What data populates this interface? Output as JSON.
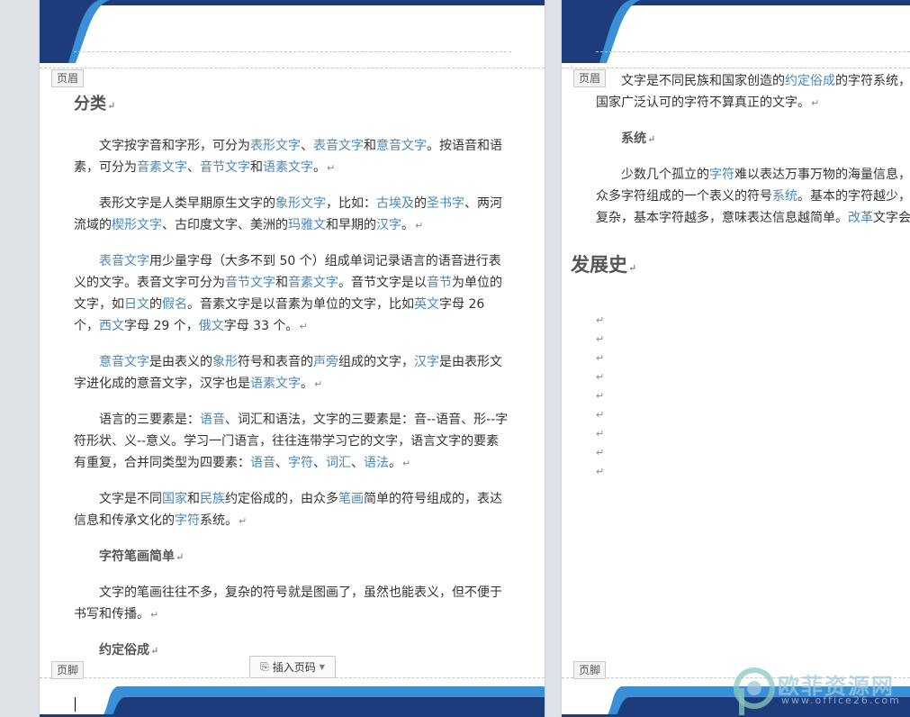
{
  "colors": {
    "accent_blue": "#1d3c7c",
    "light_blue": "#3a8fd6",
    "link": "#4b86b9"
  },
  "labels": {
    "header": "页眉",
    "footer": "页脚",
    "insert_page_number": "插入页码"
  },
  "page1": {
    "section_title": "分类",
    "p1_a": "文字按字音和字形，可分为",
    "p1_l1": "表形文字",
    "p1_b": "、",
    "p1_l2": "表音文字",
    "p1_c": "和",
    "p1_l3": "意音文字",
    "p1_d": "。按语音和语素，可分为",
    "p1_l4": "音素文字",
    "p1_e": "、",
    "p1_l5": "音节文字",
    "p1_f": "和",
    "p1_l6": "语素文字",
    "p1_g": "。",
    "p2_a": "表形文字是人类早期原生文字的",
    "p2_l1": "象形文字",
    "p2_b": "，比如：",
    "p2_l2": "古埃及",
    "p2_c": "的",
    "p2_l3": "圣书字",
    "p2_d": "、两河流域的",
    "p2_l4": "楔形文字",
    "p2_e": "、古印度文字、美洲的",
    "p2_l5": "玛雅文",
    "p2_f": "和早期的",
    "p2_l6": "汉字",
    "p2_g": "。",
    "p3_l1": "表音文字",
    "p3_a": "用少量字母（大多不到 50 个）组成单词记录语言的语音进行表义的文字。表音文字可分为",
    "p3_l2": "音节文字",
    "p3_b": "和",
    "p3_l3": "音素文字",
    "p3_c": "。音节文字是以",
    "p3_l4": "音节",
    "p3_d": "为单位的文字，如",
    "p3_l5": "日文",
    "p3_e": "的",
    "p3_l6": "假名",
    "p3_f": "。音素文字是以音素为单位的文字，比如",
    "p3_l7": "英文",
    "p3_g": "字母 26 个，",
    "p3_l8": "西文",
    "p3_h": "字母 29 个，",
    "p3_l9": "俄文",
    "p3_i": "字母 33 个。",
    "p4_l1": "意音文字",
    "p4_a": "是由表义的",
    "p4_l2": "象形",
    "p4_b": "符号和表音的",
    "p4_l3": "声旁",
    "p4_c": "组成的文字，",
    "p4_l4": "汉字",
    "p4_d": "是由表形文字进化成的意音文字，汉字也是",
    "p4_l5": "语素文字",
    "p4_e": "。",
    "p5_a": "语言的三要素是：",
    "p5_l1": "语音",
    "p5_b": "、词汇和语法，文字的三要素是：音--语音、形--字符形状、义--意义。学习一门语言，往往连带学习它的文字，语言文字的要素有重复，合并同类型为四要素：",
    "p5_l2": "语音",
    "p5_c": "、",
    "p5_l3": "字符",
    "p5_d": "、",
    "p5_l4": "词汇",
    "p5_e": "、",
    "p5_l5": "语法",
    "p5_f": "。",
    "p6_a": "文字是不同",
    "p6_l1": "国家",
    "p6_b": "和",
    "p6_l2": "民族",
    "p6_c": "约定俗成的，由众多",
    "p6_l3": "笔画",
    "p6_d": "简单的符号组成的，表达信息和传承文化的",
    "p6_l4": "字符",
    "p6_e": "系统。",
    "h_stroke": "字符笔画简单",
    "p7": "文字的笔画往往不多，复杂的符号就是图画了，虽然也能表义，但不便于书写和传播。",
    "h_convention": "约定俗成"
  },
  "page2": {
    "q1_a": "文字是不同民族和国家创造的",
    "q1_l1": "约定俗成",
    "q1_b": "的字符系统，",
    "q1_c": "国家广泛认可的字符不算真正的文字。",
    "h_system": "系统",
    "q2_a": "少数几个孤立的",
    "q2_l1": "字符",
    "q2_b": "难以表达万事万物的海量信息，",
    "q2_c": "众多字符组成的一个表义的符号",
    "q2_l2": "系统",
    "q2_d": "。基本的字符越少，",
    "q2_e": "复杂，基本字符越多，意味表达信息越简单。",
    "q2_l3": "改革",
    "q2_f": "文字会",
    "title_history": "发展史"
  },
  "watermark": {
    "name": "欧菲资源网",
    "url": "www.office26.com"
  }
}
